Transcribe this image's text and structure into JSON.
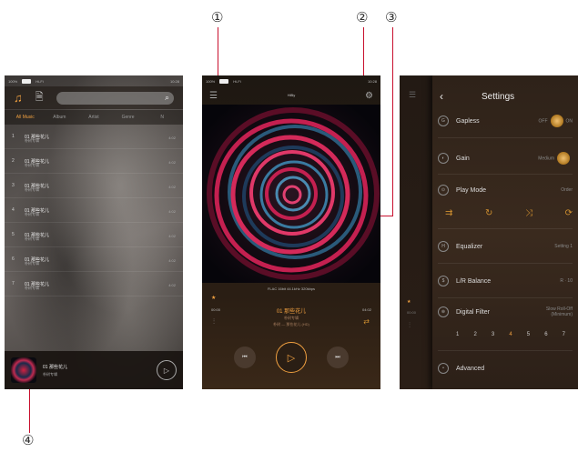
{
  "callouts": [
    "①",
    "②",
    "③",
    "④"
  ],
  "colors": {
    "accent": "#f0a040",
    "callout_line": "#c8102e"
  },
  "status": {
    "battery": "100%",
    "hires": "Hi-Fi",
    "clock": "10:28"
  },
  "library": {
    "tabs": [
      "All Music",
      "Album",
      "Artist",
      "Genre",
      "N"
    ],
    "songs": [
      {
        "num": "1",
        "title": "01 那些花儿",
        "artist": "朴树专辑",
        "dur": "4:02"
      },
      {
        "num": "2",
        "title": "01 那些花儿",
        "artist": "朴树专辑",
        "dur": "4:02"
      },
      {
        "num": "3",
        "title": "01 那些花儿",
        "artist": "朴树专辑",
        "dur": "4:02"
      },
      {
        "num": "4",
        "title": "01 那些花儿",
        "artist": "朴树专辑",
        "dur": "4:02"
      },
      {
        "num": "5",
        "title": "01 那些花儿",
        "artist": "朴树专辑",
        "dur": "4:02"
      },
      {
        "num": "6",
        "title": "01 那些花儿",
        "artist": "朴树专辑",
        "dur": "4:02"
      },
      {
        "num": "7",
        "title": "01 那些花儿",
        "artist": "朴树专辑",
        "dur": "4:02"
      }
    ],
    "mini": {
      "title": "01 那些花儿",
      "artist": "朴树专辑"
    }
  },
  "nowplaying": {
    "brand": "HiBy",
    "format": "FLAC 16bit 44.1kHz 320kbps",
    "time_elapsed": "00:00",
    "time_total": "04:02",
    "title": "01 那些花儿",
    "artist": "朴树专辑",
    "album": "朴树 — 那些花儿 (HD)",
    "prev": "⏮",
    "next": "⏭"
  },
  "settings": {
    "title": "Settings",
    "gapless": {
      "label": "Gapless",
      "off": "OFF",
      "on": "ON"
    },
    "gain": {
      "label": "Gain",
      "value": "Medium"
    },
    "play_mode": {
      "label": "Play Mode",
      "value": "Order"
    },
    "equalizer": {
      "label": "Equalizer",
      "value": "Setting 1"
    },
    "balance": {
      "label": "L/R Balance",
      "value": "R · 10"
    },
    "filter": {
      "label": "Digital Filter",
      "value": "Slow Roll-Off (Minimum)"
    },
    "filter_nums": [
      "1",
      "2",
      "3",
      "4",
      "5",
      "6",
      "7"
    ],
    "advanced": {
      "label": "Advanced"
    }
  }
}
